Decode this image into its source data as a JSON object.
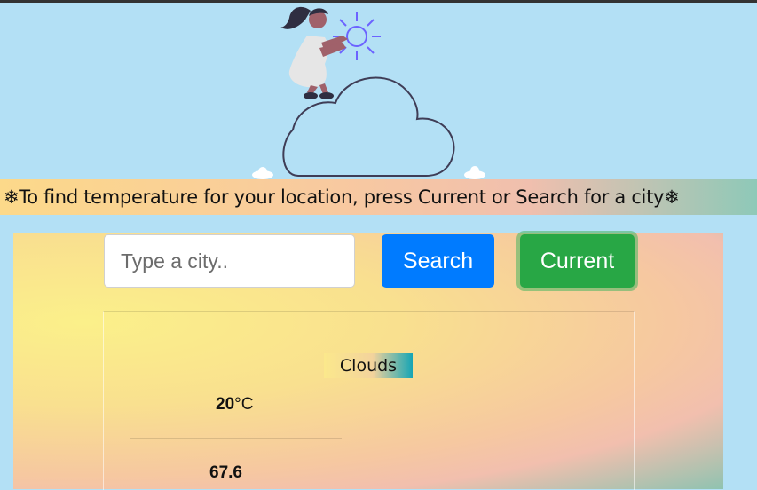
{
  "banner": {
    "text": "❄To find temperature for your location, press Current or Search for a city❄"
  },
  "search": {
    "placeholder": "Type a city..",
    "value": "",
    "search_label": "Search",
    "current_label": "Current"
  },
  "weather": {
    "condition": "Clouds",
    "temperature": "20",
    "unit": "°C",
    "second_value": "67.6"
  },
  "colors": {
    "sky": "#b3e0f5",
    "search_button": "#007bff",
    "current_button": "#28a745"
  },
  "icons": {
    "hero": "woman-on-cloud-illustration",
    "sun": "sun-icon",
    "small_clouds": "cloud-icon"
  }
}
